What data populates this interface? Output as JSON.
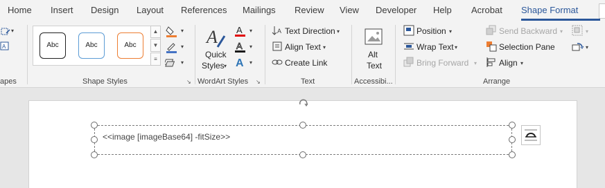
{
  "tabs": [
    {
      "label": "Home"
    },
    {
      "label": "Insert"
    },
    {
      "label": "Design"
    },
    {
      "label": "Layout"
    },
    {
      "label": "References"
    },
    {
      "label": "Mailings"
    },
    {
      "label": "Review"
    },
    {
      "label": "View"
    },
    {
      "label": "Developer"
    },
    {
      "label": "Help"
    },
    {
      "label": "Acrobat"
    },
    {
      "label": "Shape Format",
      "active": true
    }
  ],
  "groups": {
    "insert_shapes": "apes",
    "shape_styles": "Shape Styles",
    "wordart_styles": "WordArt Styles",
    "text": "Text",
    "accessibility": "Accessibi...",
    "arrange": "Arrange"
  },
  "shape_styles": {
    "presets": [
      {
        "label": "Abc",
        "border": "#1f1f1f"
      },
      {
        "label": "Abc",
        "border": "#5b9bd5"
      },
      {
        "label": "Abc",
        "border": "#ed7d31"
      }
    ]
  },
  "wordart": {
    "quick_styles_line1": "Quick",
    "quick_styles_line2": "Styles"
  },
  "text_group": {
    "text_direction": "Text Direction",
    "align_text": "Align Text",
    "create_link": "Create Link"
  },
  "accessibility": {
    "alt_line1": "Alt",
    "alt_line2": "Text"
  },
  "arrange": {
    "position": "Position",
    "wrap_text": "Wrap Text",
    "bring_forward": "Bring Forward",
    "send_backward": "Send Backward",
    "selection_pane": "Selection Pane",
    "align": "Align"
  },
  "document": {
    "textbox_content": "<<image [imageBase64] -fitSize>>"
  },
  "colors": {
    "accent": "#2b579a",
    "fill_orange": "#ed7d31",
    "outline_blue": "#4472c4",
    "text_effects_blue": "#2e75b6"
  }
}
